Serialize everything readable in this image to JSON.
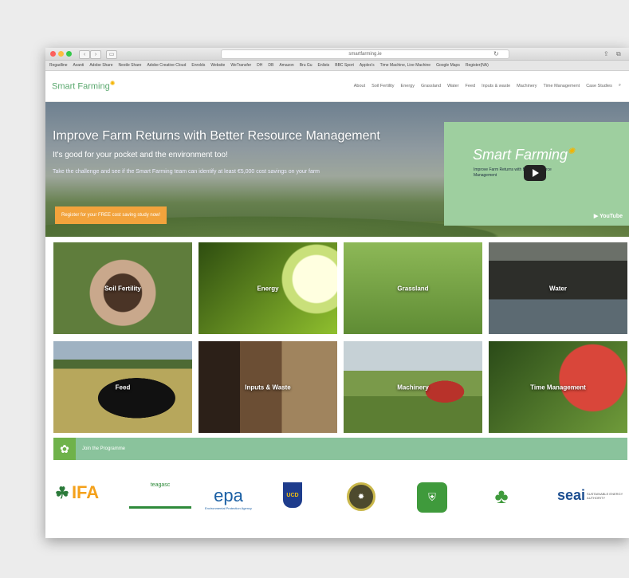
{
  "browser": {
    "url": "smartfarming.ie",
    "bookmarks": [
      "Regadline",
      "Avanti",
      "Adobe Share",
      "Nestle Share",
      "Adobe Creative Cloud",
      "Enrolds",
      "Website",
      "WeTransfer",
      "DH",
      "DB",
      "Amazon",
      "Bru Gu",
      "Enlists",
      "BBC Sport",
      "Apples's",
      "Time Machine, Live Machine",
      "Google Maps",
      "Register(NA)"
    ]
  },
  "site": {
    "logo": "Smart Farming",
    "nav": [
      "About",
      "Soil Fertility",
      "Energy",
      "Grassland",
      "Water",
      "Feed",
      "Inputs & waste",
      "Machinery",
      "Time Management",
      "Case Studies"
    ]
  },
  "hero": {
    "title": "Improve Farm Returns with Better Resource Management",
    "subtitle": "It's good for your pocket and the environment too!",
    "small": "Take the challenge and see if the Smart Farming team can identify at least €5,000 cost savings on your farm",
    "cta": "Register for your FREE cost saving study now!",
    "video": {
      "title": "Smart Farming",
      "subtitle": "Improve Farm Returns with Better Resource Management",
      "youtube": "YouTube"
    }
  },
  "tiles": [
    "Soil Fertility",
    "Energy",
    "Grassland",
    "Water",
    "Feed",
    "Inputs & Waste",
    "Machinery",
    "Time Management"
  ],
  "programme": {
    "label": "Join the Programme"
  },
  "partners": {
    "ifa": "IFA",
    "teagasc": "teagasc",
    "epa": "epa",
    "epa_caption": "Environmental Protection Agency",
    "ucd": "UCD",
    "seai": "seai",
    "seai_caption": "SUSTAINABLE ENERGY AUTHORITY"
  }
}
